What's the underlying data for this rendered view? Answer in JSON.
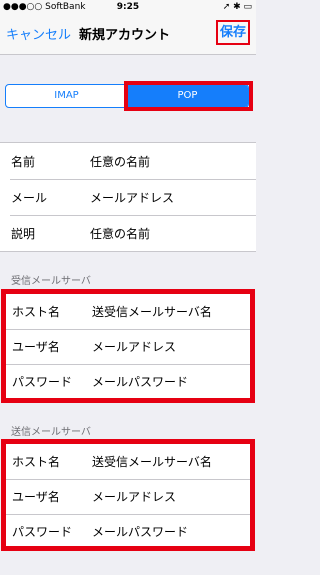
{
  "status_bar": {
    "carrier": "●●●○○ SoftBank",
    "wifi_icon": "wifi-icon",
    "time": "9:25",
    "right": "➚ ✱ ▭"
  },
  "nav": {
    "cancel": "キャンセル",
    "title": "新規アカウント",
    "save": "保存"
  },
  "segment": {
    "options": [
      "IMAP",
      "POP"
    ],
    "selected": "POP"
  },
  "account": {
    "rows": [
      {
        "label": "名前",
        "value": "任意の名前"
      },
      {
        "label": "メール",
        "value": "メールアドレス"
      },
      {
        "label": "説明",
        "value": "任意の名前"
      }
    ]
  },
  "incoming": {
    "header": "受信メールサーバ",
    "rows": [
      {
        "label": "ホスト名",
        "value": "送受信メールサーバ名"
      },
      {
        "label": "ユーザ名",
        "value": "メールアドレス"
      },
      {
        "label": "パスワード",
        "value": "メールパスワード"
      }
    ]
  },
  "outgoing": {
    "header": "送信メールサーバ",
    "rows": [
      {
        "label": "ホスト名",
        "value": "送受信メールサーバ名"
      },
      {
        "label": "ユーザ名",
        "value": "メールアドレス"
      },
      {
        "label": "パスワード",
        "value": "メールパスワード"
      }
    ]
  },
  "colors": {
    "accent": "#157efb",
    "highlight_red": "#e60012",
    "background": "#efeff4"
  }
}
